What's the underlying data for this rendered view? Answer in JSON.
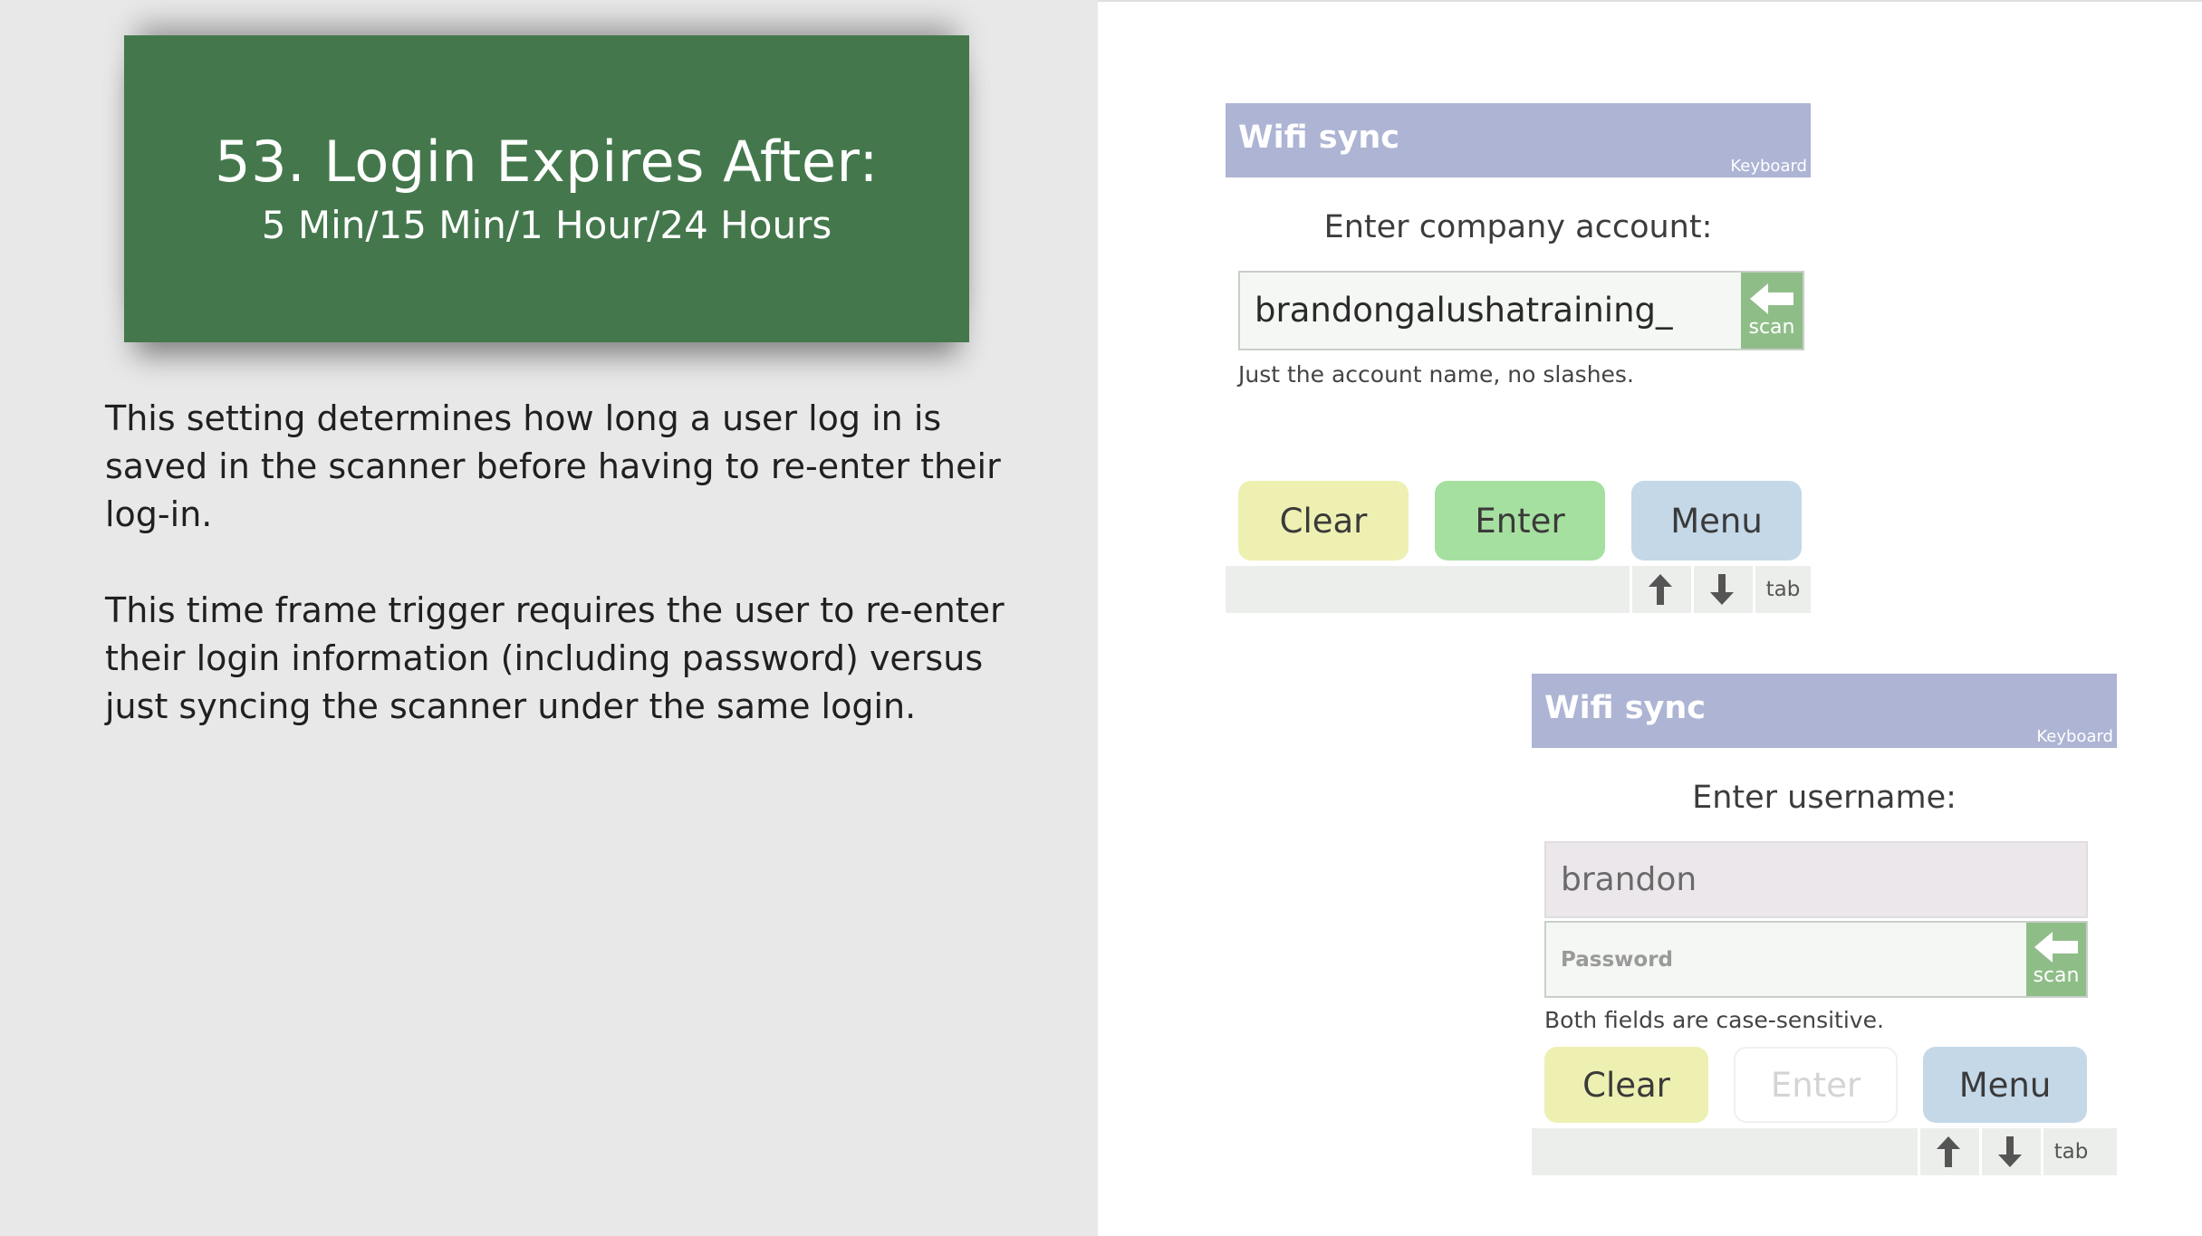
{
  "slide": {
    "title": "53. Login Expires After:",
    "subtitle": "5 Min/15 Min/1 Hour/24 Hours",
    "paragraph1": "This setting determines how long a user log in is saved in the scanner before having to re-enter their log-in.",
    "paragraph2": "This time frame trigger requires the user to re-enter their login information (including password) versus just syncing the scanner under the same login."
  },
  "screen1": {
    "title": "Wifi sync",
    "keyboard_link": "Keyboard",
    "prompt": "Enter company account:",
    "account_value": "brandongalushatraining_",
    "scan_label": "scan",
    "hint": "Just the account name, no slashes.",
    "clear_label": "Clear",
    "enter_label": "Enter",
    "menu_label": "Menu",
    "tab_label": "tab"
  },
  "screen2": {
    "title": "Wifi sync",
    "keyboard_link": "Keyboard",
    "prompt": "Enter username:",
    "username_value": "brandon",
    "password_placeholder": "Password",
    "scan_label": "scan",
    "hint": "Both fields are case-sensitive.",
    "clear_label": "Clear",
    "enter_label": "Enter",
    "menu_label": "Menu",
    "tab_label": "tab"
  },
  "colors": {
    "title_box": "#44784c",
    "titlebar": "#adb4d4",
    "scan_button": "#8fbd88",
    "clear_button": "#eef0b2",
    "enter_button": "#a6e0a0",
    "menu_button": "#c4d8e8"
  },
  "icons": {
    "scan": "arrow-left-icon",
    "up": "arrow-up-icon",
    "down": "arrow-down-icon"
  }
}
